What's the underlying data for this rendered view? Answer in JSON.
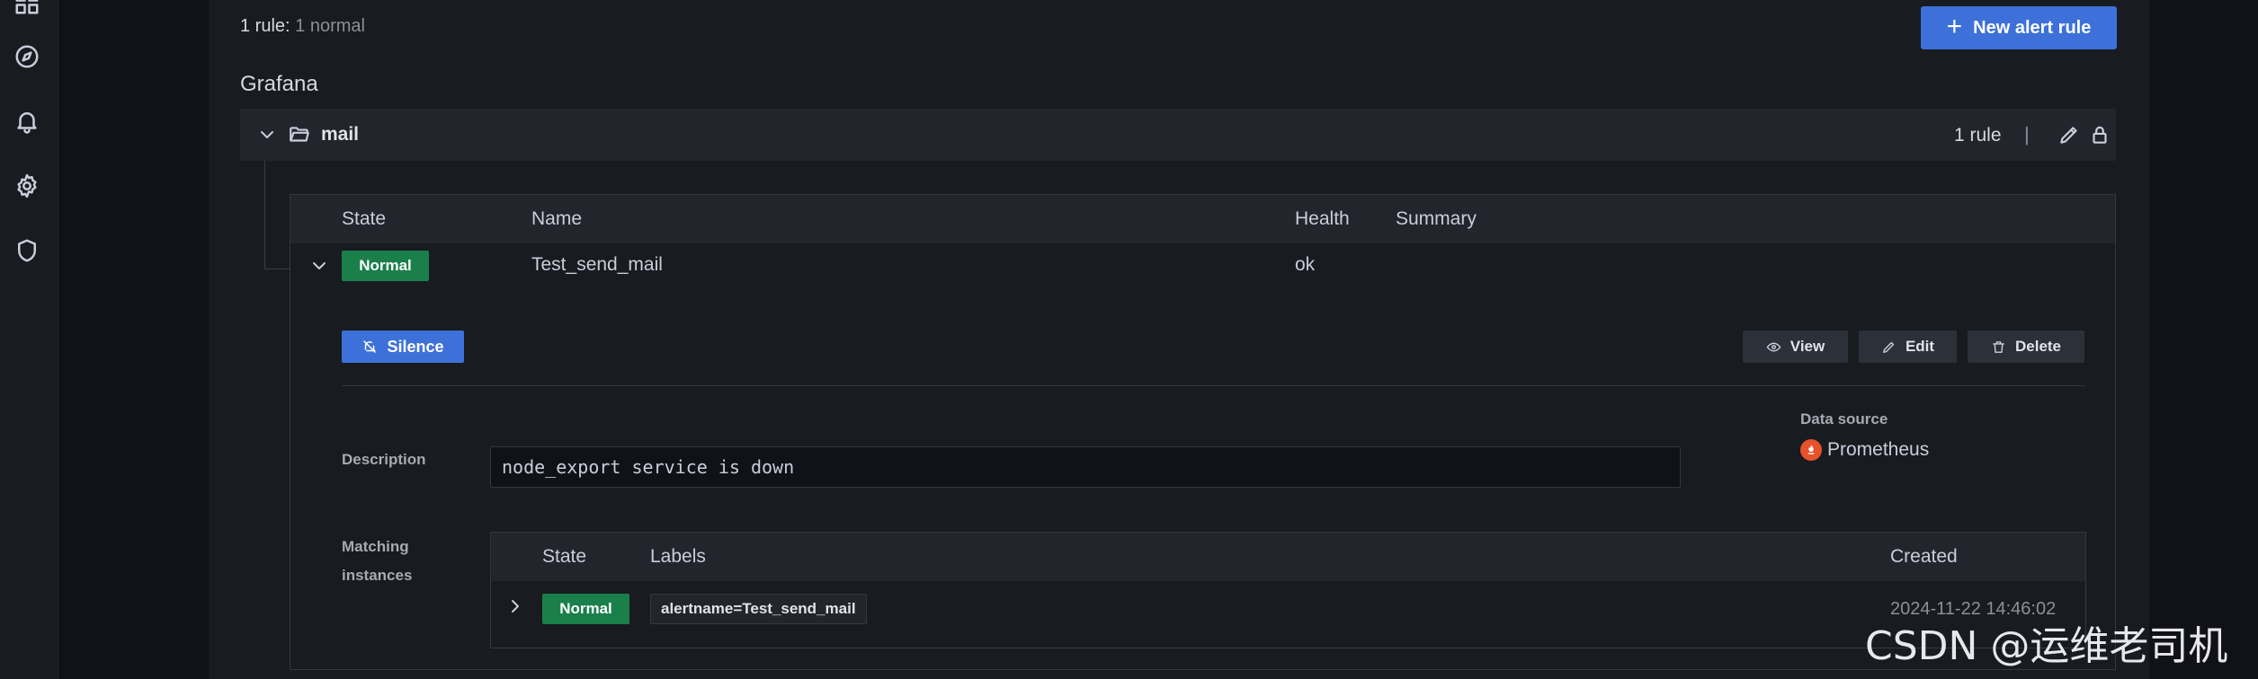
{
  "summary": {
    "count_label": "1 rule:",
    "state_label": "1 normal"
  },
  "toolbar": {
    "new_rule_label": "New alert rule"
  },
  "group": {
    "title": "Grafana"
  },
  "folder": {
    "name": "mail",
    "rule_count": "1 rule",
    "separator": "|"
  },
  "rules_table": {
    "columns": {
      "state": "State",
      "name": "Name",
      "health": "Health",
      "summary": "Summary"
    },
    "row": {
      "state": "Normal",
      "name": "Test_send_mail",
      "health": "ok",
      "summary": ""
    }
  },
  "actions": {
    "silence": "Silence",
    "view": "View",
    "edit": "Edit",
    "delete": "Delete"
  },
  "details": {
    "description_label": "Description",
    "description_value": "node_export service is down",
    "datasource_label": "Data source",
    "datasource_value": "Prometheus",
    "matching_label_line1": "Matching",
    "matching_label_line2": "instances"
  },
  "instances": {
    "columns": {
      "state": "State",
      "labels": "Labels",
      "created": "Created"
    },
    "rows": [
      {
        "state": "Normal",
        "label": "alertname=Test_send_mail",
        "created": "2024-11-22 14:46:02"
      }
    ]
  },
  "watermark": "CSDN @运维老司机",
  "colors": {
    "accent": "#3d71d9",
    "normal": "#1a7f4b",
    "prometheus": "#e6522c"
  }
}
